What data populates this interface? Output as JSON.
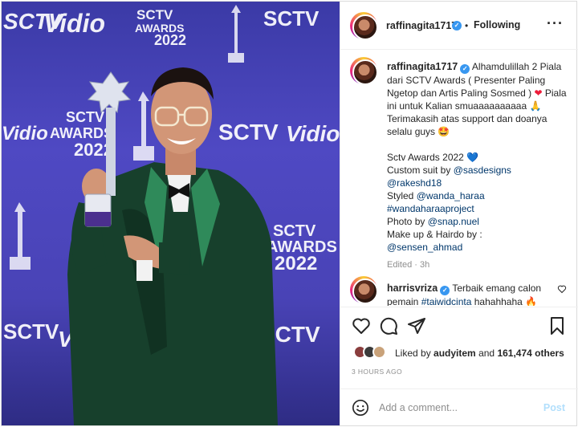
{
  "header": {
    "username": "raffinagita1717",
    "separator": "•",
    "follow_status": "Following",
    "more": "···"
  },
  "photo": {
    "logos": {
      "vidio": "Vidio",
      "sctv": "SCTV",
      "awards_line1": "SCTV",
      "awards_line2": "AWARDS",
      "year": "2022"
    }
  },
  "caption": {
    "username": "raffinagita1717",
    "line1": "Alhamdulillah 2 Piala dari SCTV Awards ( Presenter Paling Ngetop dan Artis Paling Sosmed )",
    "line1_emoji": "❤",
    "line2": "Piala ini untuk Kalian smuaaaaaaaaaa",
    "line2_emoji": "🙏",
    "line3": "Terimakasih atas support dan doanya selalu guys",
    "line3_emoji": "🤩",
    "awards": "Sctv Awards 2022",
    "awards_emoji": "💙",
    "suit_label": "Custom suit by",
    "suit_by": "@sasdesigns",
    "mention2": "@rakeshd18",
    "styled_label": "Styled",
    "styled_by": "@wanda_haraa",
    "tag": "#wandaharaaproject",
    "photo_label": "Photo by",
    "photo_by": "@snap.nuel",
    "makeup_label": "Make up & Hairdo by :",
    "makeup_by": "@sensen_ahmad",
    "meta": "Edited · 3h"
  },
  "comment": {
    "username": "harrisvriza",
    "text_a": "Terbaik emang calon pemain",
    "tag": "#taiwidcinta",
    "text_b": "hahahhaha",
    "emoji": "🔥"
  },
  "likes": {
    "prefix": "Liked by",
    "user": "audyitem",
    "joiner": "and",
    "count": "161,474 others"
  },
  "time_ago": "3 HOURS AGO",
  "add_comment": {
    "placeholder": "Add a comment...",
    "post_label": "Post"
  },
  "colors": {
    "link": "#00376b",
    "verified": "#3897f0",
    "post_disabled": "#b2dffc",
    "muted": "#8e8e8e"
  }
}
